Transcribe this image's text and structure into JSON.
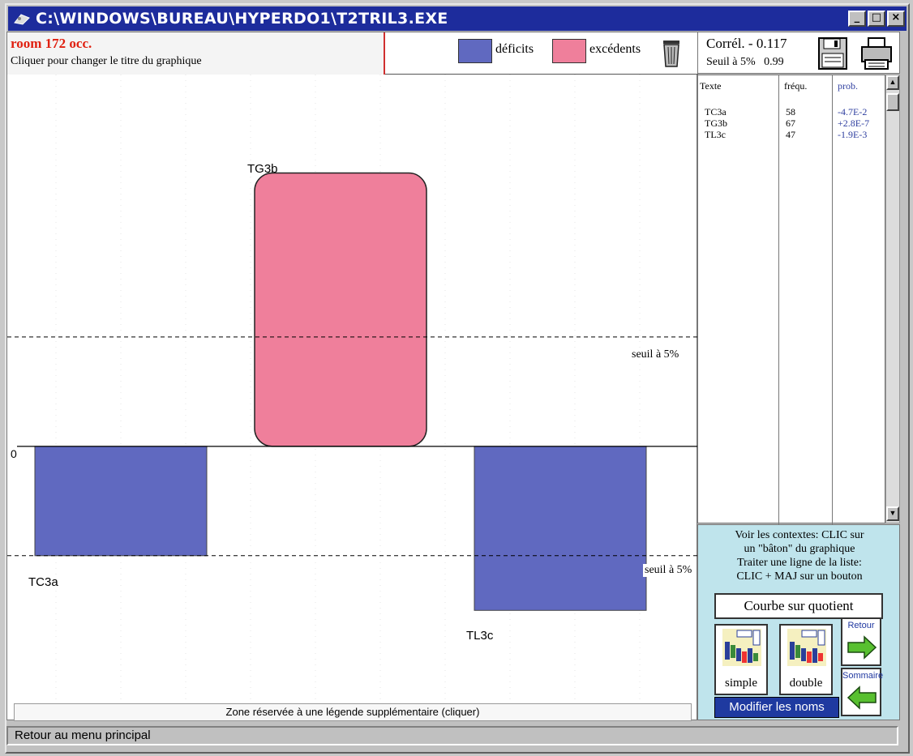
{
  "window": {
    "title": "C:\\WINDOWS\\BUREAU\\HYPERDO1\\T2TRIL3.EXE",
    "min": "_",
    "max": "□",
    "close": "×"
  },
  "header": {
    "room": "room  172 occ.",
    "subtitle": "Cliquer pour changer le titre du graphique",
    "legend": [
      {
        "label": "déficits",
        "color": "#6069c0"
      },
      {
        "label": "excédents",
        "color": "#ef7f9b"
      }
    ]
  },
  "chart_data": {
    "type": "bar",
    "categories": [
      "TC3a",
      "TG3b",
      "TL3c"
    ],
    "bars": [
      {
        "label": "TC3a",
        "kind": "déficits",
        "value": -1.0
      },
      {
        "label": "TG3b",
        "kind": "excédents",
        "value": 2.5
      },
      {
        "label": "TL3c",
        "kind": "déficits",
        "value": -1.5
      }
    ],
    "zero_label": "0",
    "threshold_label": "seuil à 5%",
    "ylim": [
      -2.35,
      3.4
    ],
    "thresholds": [
      1.0,
      -1.0
    ],
    "colors": {
      "deficit": "#6069c0",
      "excedent": "#ef7f9b"
    }
  },
  "legend_zone": "Zone réservée à une légende supplémentaire (cliquer)",
  "stats": {
    "corr": "Corrél. - 0.117",
    "seuil": "Seuil à 5%",
    "seuil_val": "0.99"
  },
  "table": {
    "headers": [
      "Texte",
      "fréqu.",
      "prob."
    ],
    "rows": [
      {
        "texte": "TC3a",
        "freq": "58",
        "prob": "-4.7E-2"
      },
      {
        "texte": "TG3b",
        "freq": "67",
        "prob": "+2.8E-7"
      },
      {
        "texte": "TL3c",
        "freq": "47",
        "prob": "-1.9E-3"
      }
    ]
  },
  "help": {
    "line1": "Voir les contextes: CLIC sur",
    "line2": "un \"bâton\" du graphique",
    "line3": "Traiter une ligne de la liste:",
    "line4": "CLIC + MAJ sur un bouton"
  },
  "buttons": {
    "courbe": "Courbe sur quotient",
    "simple": "simple",
    "double": "double",
    "retour": "Retour",
    "sommaire": "Sommaire",
    "modifier": "Modifier les noms"
  },
  "status": "Retour au menu principal"
}
